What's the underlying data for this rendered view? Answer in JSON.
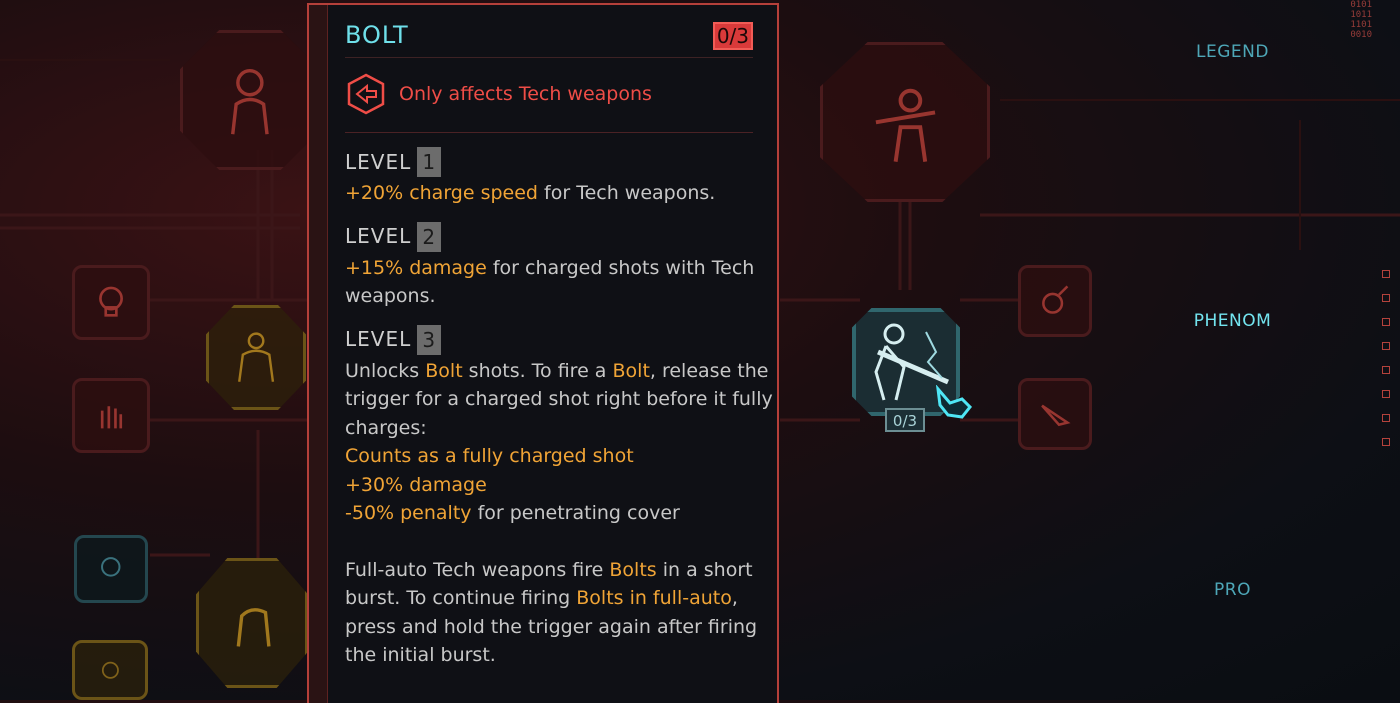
{
  "tooltip": {
    "title": "BOLT",
    "counter": "0/3",
    "restriction": "Only affects Tech weapons",
    "levels": [
      {
        "label": "LEVEL",
        "number": "1",
        "lines": [
          {
            "hl": "+20% charge speed",
            "rest": " for Tech weapons."
          }
        ]
      },
      {
        "label": "LEVEL",
        "number": "2",
        "line1_hl": "+15% damage",
        "line1_rest": " for charged shots with Tech",
        "line2": "weapons."
      },
      {
        "label": "LEVEL",
        "number": "3",
        "unlocks_a": "Unlocks ",
        "unlocks_bolt": "Bolt",
        "unlocks_b": " shots. To fire a ",
        "unlocks_bolt2": "Bolt",
        "unlocks_c": ", release the",
        "line2": "trigger for a charged shot right before it fully",
        "line3": "charges:",
        "effect1": "Counts as a fully charged shot",
        "effect2": "+30% damage",
        "effect3_hl": "-50% penalty",
        "effect3_rest": " for penetrating cover"
      }
    ],
    "fullauto": {
      "p1": "Full-auto Tech weapons fire ",
      "p1_hl": "Bolts",
      "p1_end": " in a short",
      "p2": "burst. To continue firing ",
      "p2_hl": "Bolts in full-auto",
      "p2_end": ",",
      "p3": "press and hold the trigger again after firing",
      "p4": "the initial burst."
    }
  },
  "selected_perk": {
    "counter": "0/3"
  },
  "tiers": {
    "legend": "LEGEND",
    "phenom": "PHENOM",
    "pro": "PRO"
  },
  "binary": [
    "0101",
    "1011",
    "1101",
    "0010"
  ],
  "colors": {
    "accent_red": "#d93a3a",
    "title_cyan": "#6fe0ea",
    "highlight_orange": "#f0a436"
  }
}
